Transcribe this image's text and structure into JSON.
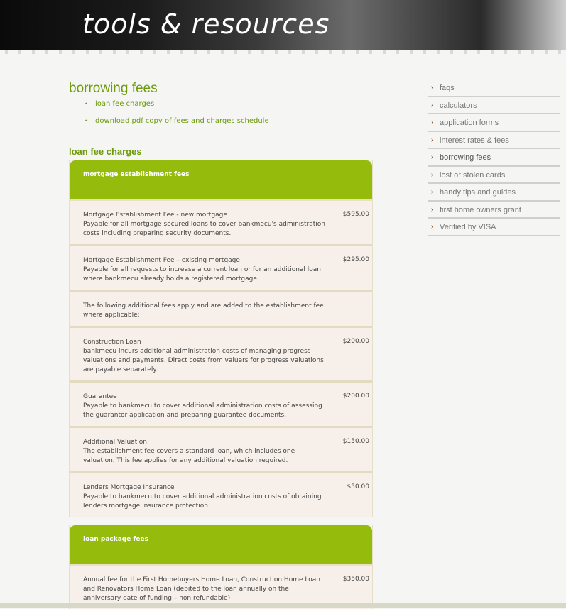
{
  "banner": {
    "title": "tools & resources"
  },
  "page": {
    "title": "borrowing fees",
    "links": [
      "loan fee charges",
      "download pdf copy of fees and charges schedule"
    ],
    "section_title": "loan fee charges"
  },
  "mortgage": {
    "header": "mortgage establishment fees",
    "rows": [
      {
        "title": "Mortgage Establishment Fee - new mortgage",
        "desc": "Payable for all mortgage secured loans to cover bankmecu's administration costs including preparing security documents.",
        "amount": "$595.00"
      },
      {
        "title": "Mortgage Establishment Fee – existing mortgage",
        "desc": "Payable for all requests to increase a current loan or for an additional loan where bankmecu already holds a registered mortgage.",
        "amount": "$295.00"
      },
      {
        "title": "",
        "desc": "The following additional fees apply and are added to the establishment fee where applicable;",
        "amount": ""
      },
      {
        "title": "Construction Loan",
        "desc": "bankmecu incurs additional administration costs of managing progress valuations and payments. Direct costs from valuers for progress valuations are payable separately.",
        "amount": "$200.00"
      },
      {
        "title": "Guarantee",
        "desc": "Payable to bankmecu to cover additional administration costs of assessing the guarantor application and preparing guarantee documents.",
        "amount": "$200.00"
      },
      {
        "title": "Additional Valuation",
        "desc": "The establishment fee covers a standard loan, which includes one valuation. This fee applies for any additional valuation required.",
        "amount": "$150.00"
      },
      {
        "title": "Lenders Mortgage Insurance",
        "desc": "Payable to bankmecu to cover additional administration costs of obtaining lenders mortgage insurance protection.",
        "amount": "$50.00"
      }
    ]
  },
  "package": {
    "header": "loan package fees",
    "rows": [
      {
        "title": "Annual fee for the First Homebuyers Home Loan, Construction Home Loan and Renovators Home Loan (debited to the loan annually on the anniversary date of funding – non refundable)",
        "desc": "",
        "amount": "$350.00"
      }
    ]
  },
  "sidebar": {
    "items": [
      "faqs",
      "calculators",
      "application forms",
      "interest rates & fees",
      "borrowing fees",
      "lost or stolen cards",
      "handy tips and guides",
      "first home owners grant",
      "Verified by VISA"
    ],
    "active_index": 4
  },
  "colors": {
    "accent_green": "#95bb0d",
    "text_green": "#6e9a0c",
    "row_bg": "#f7f0ea"
  }
}
